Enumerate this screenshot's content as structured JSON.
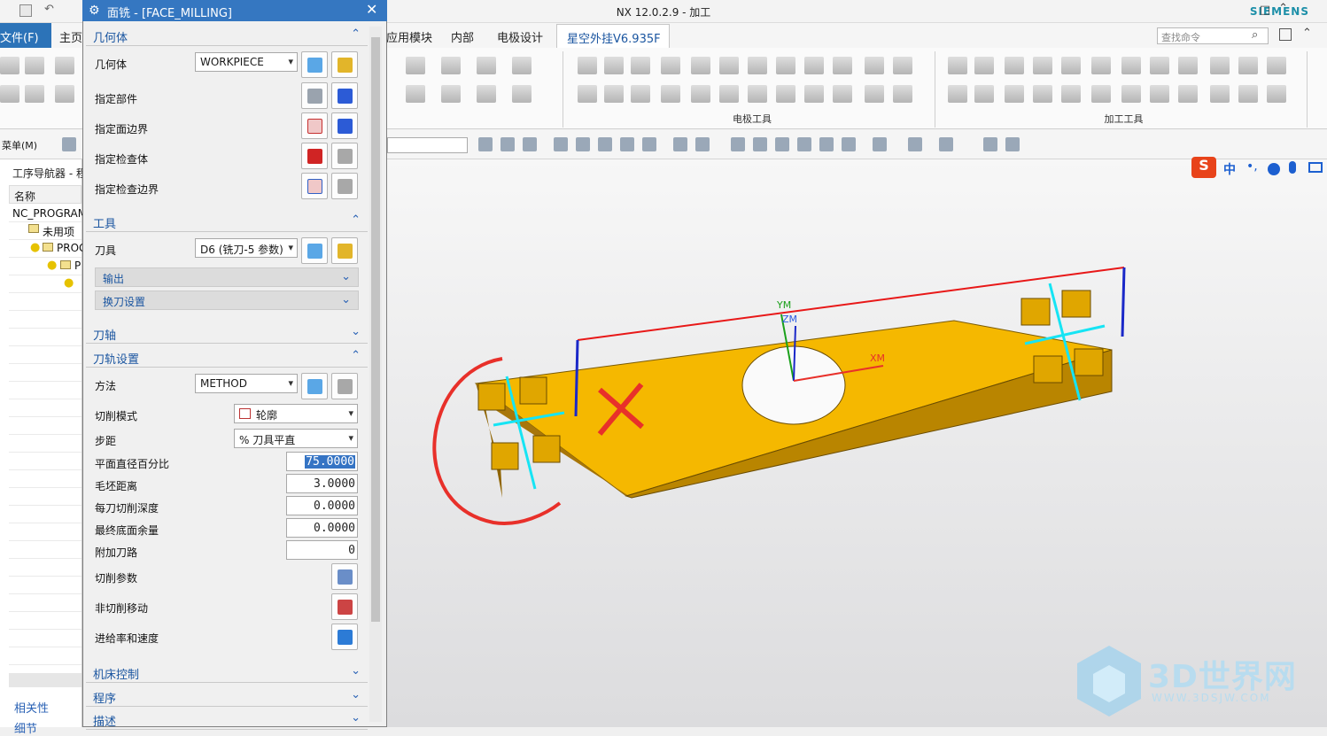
{
  "app": {
    "title": "NX 12.0.2.9 - 加工",
    "brand": "SIEMENS"
  },
  "ribbon": {
    "file_tab": "文件(F)",
    "tabs": [
      "主页",
      "应用模块",
      "内部",
      "电极设计"
    ],
    "active_tab": "星空外挂V6.935F",
    "search_placeholder": "查找命令",
    "groups": [
      "电极工具",
      "加工工具"
    ]
  },
  "toolbar": {
    "menu_label": "菜单(M)"
  },
  "navigator": {
    "title": "工序导航器 - 程",
    "column_name": "名称",
    "rows": [
      "NC_PROGRAM",
      "未用项",
      "PROG",
      "P"
    ],
    "footer": [
      "相关性",
      "细节"
    ]
  },
  "dialog": {
    "title": "面铣 - [FACE_MILLING]",
    "sections": {
      "geometry": "几何体",
      "tool": "工具",
      "axis": "刀轴",
      "path": "刀轨设置",
      "machine": "机床控制",
      "program": "程序",
      "desc": "描述"
    },
    "geometry": {
      "label": "几何体",
      "value": "WORKPIECE",
      "rows": [
        "指定部件",
        "指定面边界",
        "指定检查体",
        "指定检查边界"
      ]
    },
    "tool": {
      "label": "刀具",
      "value": "D6 (铣刀-5 参数)",
      "output": "输出",
      "change": "换刀设置"
    },
    "path": {
      "method_label": "方法",
      "method_value": "METHOD",
      "cut_mode_label": "切削模式",
      "cut_mode_value": "轮廓",
      "stepover_label": "步距",
      "stepover_value": "% 刀具平直",
      "fields": [
        {
          "label": "平面直径百分比",
          "value": "75.0000"
        },
        {
          "label": "毛坯距离",
          "value": "3.0000"
        },
        {
          "label": "每刀切削深度",
          "value": "0.0000"
        },
        {
          "label": "最终底面余量",
          "value": "0.0000"
        },
        {
          "label": "附加刀路",
          "value": "0"
        }
      ],
      "actions": [
        "切削参数",
        "非切削移动",
        "进给率和速度"
      ]
    }
  },
  "viewport": {
    "axes": {
      "ym": "YM",
      "zm": "ZM",
      "xm": "XM"
    },
    "ime": "中",
    "watermark_text": "3D世界网",
    "watermark_url": "WWW.3DSJW.COM"
  },
  "colors": {
    "accent": "#3577c1",
    "part": "#f5b800",
    "annotation": "#e8302a"
  }
}
